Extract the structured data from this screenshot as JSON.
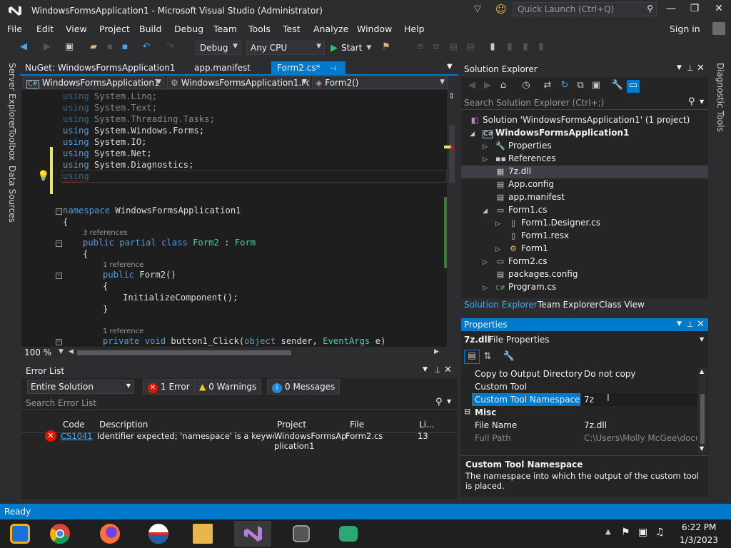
{
  "window": {
    "title": "WindowsFormsApplication1 - Microsoft Visual Studio (Administrator)"
  },
  "quick_launch": {
    "placeholder": "Quick Launch (Ctrl+Q)"
  },
  "menu": [
    "File",
    "Edit",
    "View",
    "Project",
    "Build",
    "Debug",
    "Team",
    "Tools",
    "Test",
    "Analyze",
    "Window",
    "Help"
  ],
  "sign_in": "Sign in",
  "toolbar": {
    "config": "Debug",
    "platform": "Any CPU",
    "start": "Start"
  },
  "left_tabs": [
    "Server Explorer",
    "Toolbox",
    "Data Sources"
  ],
  "doc_tabs": [
    "NuGet: WindowsFormsApplication1",
    "app.manifest",
    "Form2.cs*"
  ],
  "navbar": {
    "project": "WindowsFormsApplication1",
    "class": "WindowsFormsApplication1.Fo",
    "member": "Form2()"
  },
  "code": {
    "using_lines": [
      "System.Linq;",
      "System.Text;",
      "System.Threading.Tasks;",
      "System.Windows.Forms;",
      "System.IO;",
      "System.Net;",
      "System.Diagnostics;"
    ],
    "using_kw": "using",
    "namespace_kw": "namespace",
    "namespace_name": "WindowsFormsApplication1",
    "open_brace": "{",
    "close_brace": "}",
    "refs3": "3 references",
    "class_line_kw": "public partial class",
    "class_name": "Form2",
    "colon": " : ",
    "base_class": "Form",
    "ref1": "1 reference",
    "ctor_kw": "public",
    "ctor_sig": "Form2()",
    "init_call": "InitializeComponent();",
    "method_kw": "private void",
    "method_name": "button1_Click(",
    "param_kw": "object",
    "param_rest": " sender, ",
    "param_type": "EventArgs",
    "param_end": " e)"
  },
  "zoom": "100 %",
  "error_list": {
    "title": "Error List",
    "scope": "Entire Solution",
    "errors": "1 Error",
    "warnings": "0 Warnings",
    "messages": "0 Messages",
    "search_placeholder": "Search Error List",
    "columns": [
      "Code",
      "Description",
      "Project",
      "File",
      "Li..."
    ],
    "rows": [
      {
        "code": "CS1041",
        "description": "Identifier expected; 'namespace' is a keyword",
        "project": "WindowsFormsAp plication1",
        "file": "Form2.cs",
        "line": "13"
      }
    ]
  },
  "solution_explorer": {
    "title": "Solution Explorer",
    "search_placeholder": "Search Solution Explorer (Ctrl+;)",
    "items": [
      {
        "label": "Solution 'WindowsFormsApplication1' (1 project)",
        "icon": "solution-icon"
      },
      {
        "label": "WindowsFormsApplication1",
        "icon": "csharp-project-icon"
      },
      {
        "label": "Properties",
        "icon": "wrench-icon"
      },
      {
        "label": "References",
        "icon": "references-icon"
      },
      {
        "label": "7z.dll",
        "icon": "dll-icon"
      },
      {
        "label": "App.config",
        "icon": "config-icon"
      },
      {
        "label": "app.manifest",
        "icon": "manifest-icon"
      },
      {
        "label": "Form1.cs",
        "icon": "form-icon"
      },
      {
        "label": "Form1.Designer.cs",
        "icon": "cs-file-icon"
      },
      {
        "label": "Form1.resx",
        "icon": "resx-icon"
      },
      {
        "label": "Form1",
        "icon": "class-icon"
      },
      {
        "label": "Form2.cs",
        "icon": "form-icon"
      },
      {
        "label": "packages.config",
        "icon": "config-icon"
      },
      {
        "label": "Program.cs",
        "icon": "cs-file-icon"
      }
    ],
    "tabs": [
      "Solution Explorer",
      "Team Explorer",
      "Class View"
    ]
  },
  "properties": {
    "title": "Properties",
    "object_name": "7z.dll",
    "object_type": "File Properties",
    "rows": [
      {
        "name": "Copy to Output Directory",
        "value": "Do not copy"
      },
      {
        "name": "Custom Tool",
        "value": ""
      },
      {
        "name": "Custom Tool Namespace",
        "value": "7z"
      }
    ],
    "category": "Misc",
    "misc_rows": [
      {
        "name": "File Name",
        "value": "7z.dll"
      },
      {
        "name": "Full Path",
        "value": "C:\\Users\\Molly McGee\\docum"
      }
    ],
    "desc_title": "Custom Tool Namespace",
    "desc_text": "The namespace into which the output of the custom tool is placed."
  },
  "status": {
    "text": "Ready"
  },
  "taskbar": {
    "time": "6:22 PM",
    "date": "1/3/2023"
  },
  "colors": {
    "accent": "#007acc",
    "error": "#e51400",
    "editor_bg": "#1e1e1e",
    "keyword": "#569cd6",
    "type": "#4ec9b0"
  }
}
